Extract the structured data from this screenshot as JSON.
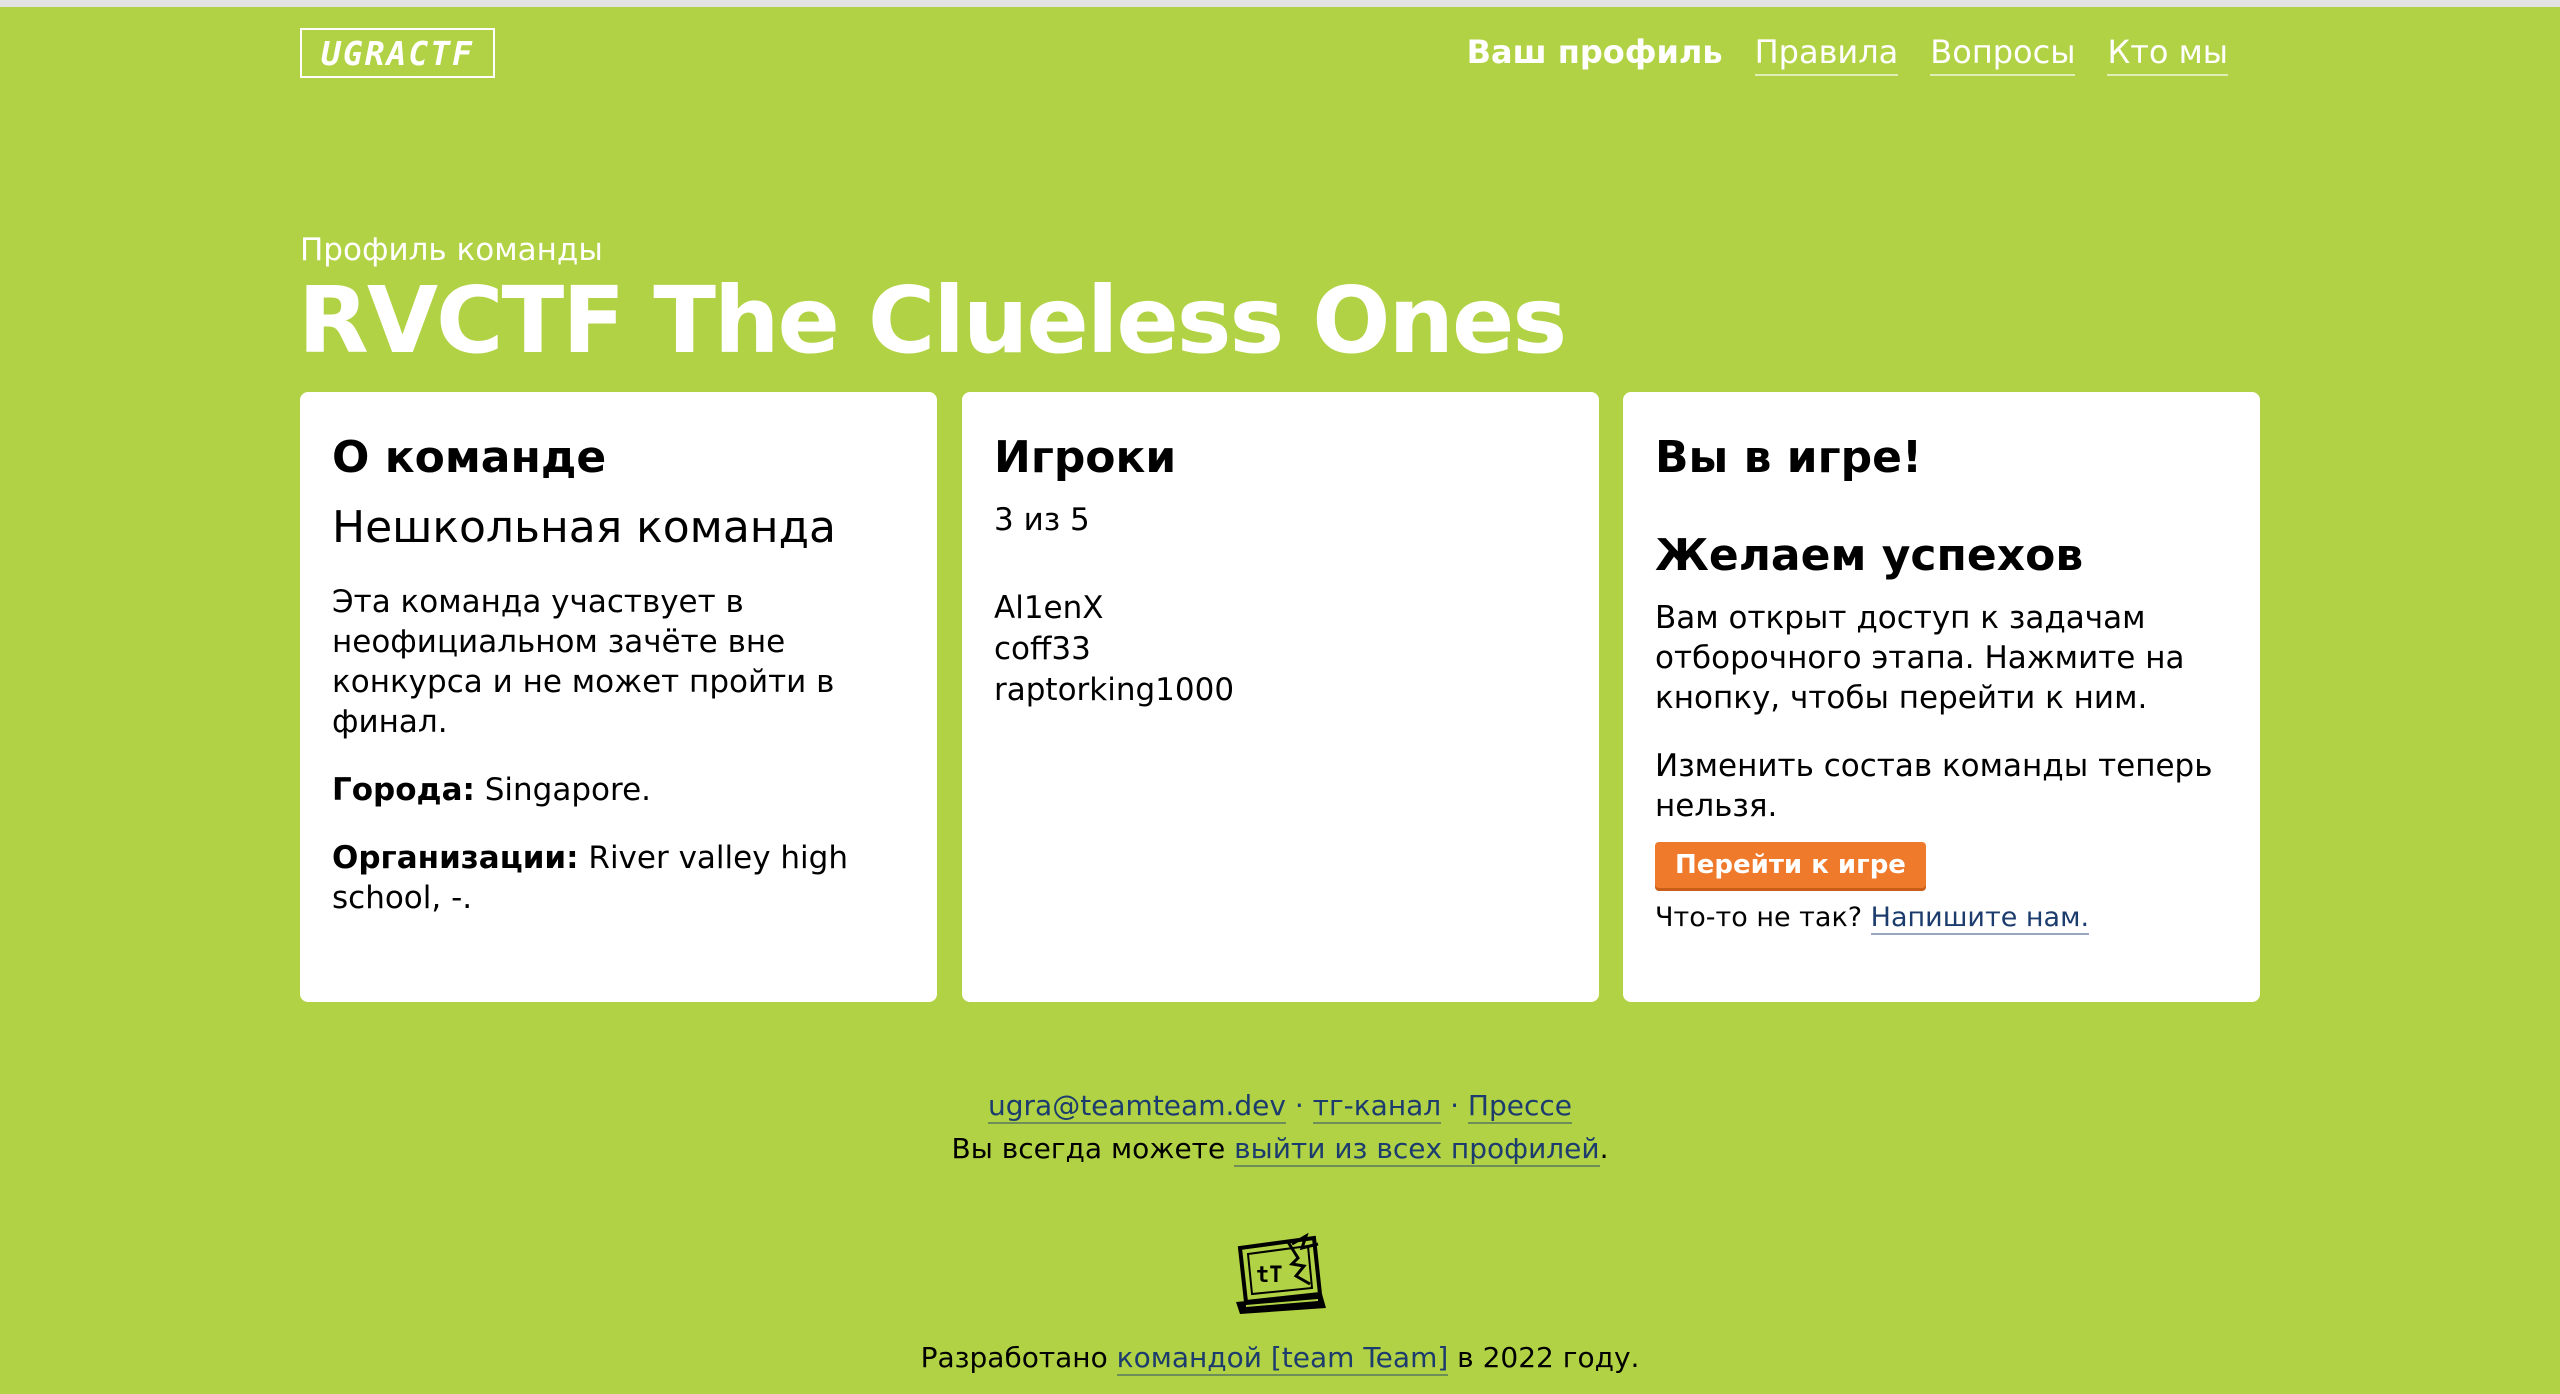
{
  "header": {
    "logo_text": "UGRACTF",
    "nav": [
      {
        "label": "Ваш профиль",
        "active": true
      },
      {
        "label": "Правила",
        "active": false
      },
      {
        "label": "Вопросы",
        "active": false
      },
      {
        "label": "Кто мы",
        "active": false
      }
    ]
  },
  "page": {
    "subtitle": "Профиль команды",
    "title": "RVCTF The Clueless Ones"
  },
  "about": {
    "heading": "О команде",
    "type": "Нешкольная команда",
    "description": "Эта команда участвует в неофициальном зачёте вне конкурса и не может пройти в финал.",
    "cities_label": "Города:",
    "cities_value": " Singapore.",
    "orgs_label": "Организации:",
    "orgs_value": " River valley high school, -."
  },
  "players": {
    "heading": "Игроки",
    "count": "3 из 5",
    "list": [
      "Al1enX",
      "coff33",
      "raptorking1000"
    ]
  },
  "status": {
    "heading": "Вы в игре!",
    "subheading": "Желаем успехов",
    "text1": "Вам открыт доступ к задачам отборочного этапа. Нажмите на кнопку, чтобы перейти к ним.",
    "text2": "Изменить состав команды теперь нельзя.",
    "button_label": "Перейти к игре",
    "help_prefix": "Что-то не так? ",
    "help_link": "Напишите нам."
  },
  "footer": {
    "email": "ugra@teamteam.dev",
    "separator": " · ",
    "tg": "тг-канал",
    "press": "Прессе",
    "logout_prefix": "Вы всегда можете ",
    "logout_link": "выйти из всех профилей",
    "logout_suffix": ".",
    "credits_prefix": "Разработано ",
    "credits_link": "командой [team Team]",
    "credits_suffix": " в 2022 году."
  },
  "colors": {
    "background": "#b1d244",
    "button": "#ef7a2b",
    "link": "#1c3c6e"
  },
  "icons": {
    "team_logo": "team-team-logo-icon"
  }
}
